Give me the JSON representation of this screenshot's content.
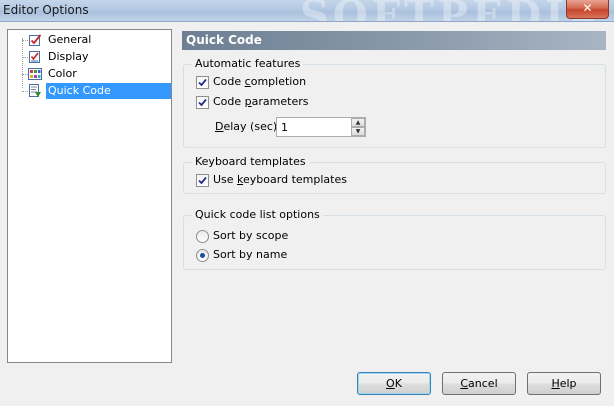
{
  "window": {
    "title": "Editor Options",
    "watermark": "SOFTPEDIA",
    "close_glyph": "✕"
  },
  "tree": {
    "items": [
      {
        "label": "General",
        "icon": "general-icon",
        "selected": false
      },
      {
        "label": "Display",
        "icon": "display-icon",
        "selected": false
      },
      {
        "label": "Color",
        "icon": "color-icon",
        "selected": false
      },
      {
        "label": "Quick Code",
        "icon": "quick-code-icon",
        "selected": true
      }
    ]
  },
  "panel": {
    "title": "Quick Code",
    "automatic": {
      "legend": "Automatic features",
      "code_completion": {
        "label_pre": "Code ",
        "label_u": "c",
        "label_post": "ompletion",
        "checked": true
      },
      "code_parameters": {
        "label_pre": "Code ",
        "label_u": "p",
        "label_post": "arameters",
        "checked": true
      },
      "delay": {
        "label_u": "D",
        "label_post": "elay (sec):",
        "value": "1"
      }
    },
    "keyboard": {
      "legend": "Keyboard templates",
      "use_templates": {
        "label_pre": "Use ",
        "label_u": "k",
        "label_post": "eyboard templates",
        "checked": true
      }
    },
    "quick_list": {
      "legend": "Quick code list options",
      "sort_scope": {
        "label": "Sort by scope",
        "selected": false
      },
      "sort_name": {
        "label": "Sort by name",
        "selected": true
      }
    }
  },
  "buttons": {
    "ok": {
      "label_u": "O",
      "label_post": "K"
    },
    "cancel": {
      "label_u": "C",
      "label_post": "ancel"
    },
    "help": {
      "label_u": "H",
      "label_post": "elp"
    }
  },
  "colors": {
    "selection": "#3399ff",
    "header_bar": "#7d8ea2",
    "title_bar": "#b3c8e2",
    "close_button": "#c7452a"
  }
}
